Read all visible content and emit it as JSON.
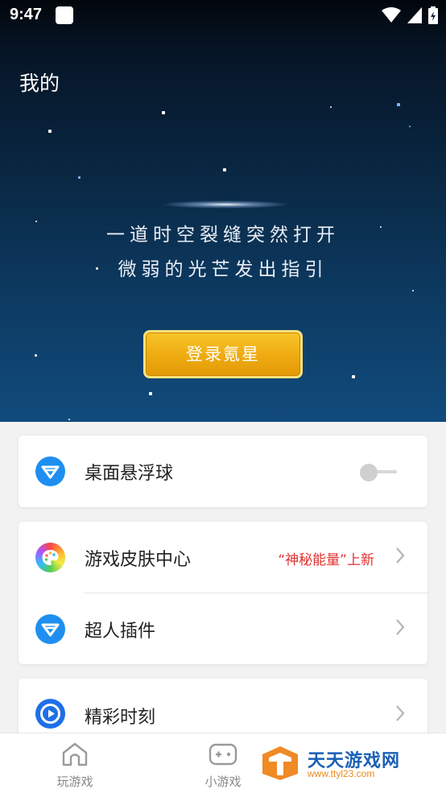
{
  "status_bar": {
    "time": "9:47"
  },
  "header": {
    "title": "我的"
  },
  "hero": {
    "tagline_line1": "一道时空裂缝突然打开",
    "tagline_line2": "微弱的光芒发出指引",
    "login_label": "登录氪星"
  },
  "settings": {
    "floating_ball": {
      "label": "桌面悬浮球",
      "enabled": false,
      "icon": "v-logo-icon"
    },
    "skin_center": {
      "label": "游戏皮肤中心",
      "promo": "“神秘能量”上新",
      "icon": "palette-icon"
    },
    "superman_plugin": {
      "label": "超人插件",
      "icon": "v-logo-icon"
    },
    "highlights": {
      "label": "精彩时刻",
      "icon": "play-icon"
    }
  },
  "bottom_nav": {
    "tabs": [
      {
        "label": "玩游戏",
        "icon": "home-icon"
      },
      {
        "label": "小游戏",
        "icon": "gamepad-icon"
      }
    ]
  },
  "watermark": {
    "name": "天天游戏网",
    "url": "www.ttyl23.com"
  },
  "colors": {
    "accent_blue": "#1e8ff0",
    "promo_red": "#e0312f",
    "login_gold": "#eeaa10"
  }
}
